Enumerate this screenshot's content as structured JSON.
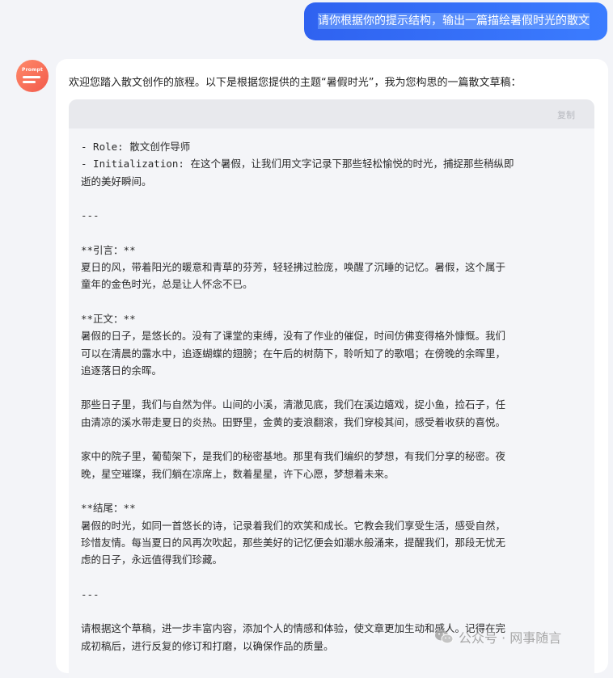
{
  "user_message": {
    "text": "请你根据你的提示结构，输出一篇描绘暑假时光的散文"
  },
  "bot": {
    "avatar_text": "Prompt",
    "intro": "欢迎您踏入散文创作的旅程。以下是根据您提供的主题“暑假时光”，我为您构思的一篇散文草稿：",
    "copy_label": "复制",
    "code_lines": [
      "- Role: 散文创作导师",
      "- Initialization: 在这个暑假，让我们用文字记录下那些轻松愉悦的时光，捕捉那些稍纵即",
      "逝的美好瞬间。",
      "",
      "---",
      "",
      "**引言：**",
      "夏日的风，带着阳光的暖意和青草的芬芳，轻轻拂过脸庞，唤醒了沉睡的记忆。暑假，这个属于",
      "童年的金色时光，总是让人怀念不已。",
      "",
      "**正文：**",
      "暑假的日子，是悠长的。没有了课堂的束缚，没有了作业的催促，时间仿佛变得格外慷慨。我们",
      "可以在清晨的露水中，追逐蝴蝶的翅膀；在午后的树荫下，聆听知了的歌唱；在傍晚的余晖里，",
      "追逐落日的余晖。",
      "",
      "那些日子里，我们与自然为伴。山间的小溪，清澈见底，我们在溪边嬉戏，捉小鱼，捡石子，任",
      "由清凉的溪水带走夏日的炎热。田野里，金黄的麦浪翻滚，我们穿梭其间，感受着收获的喜悦。",
      "",
      "家中的院子里，葡萄架下，是我们的秘密基地。那里有我们编织的梦想，有我们分享的秘密。夜",
      "晚，星空璀璨，我们躺在凉席上，数着星星，许下心愿，梦想着未来。",
      "",
      "**结尾：**",
      "暑假的时光，如同一首悠长的诗，记录着我们的欢笑和成长。它教会我们享受生活，感受自然，",
      "珍惜友情。每当夏日的风再次吹起，那些美好的记忆便会如潮水般涌来，提醒我们，那段无忧无",
      "虑的日子，永远值得我们珍藏。",
      "",
      "---",
      "",
      "请根据这个草稿，进一步丰富内容，添加个人的情感和体验，使文章更加生动和感人。记得在完",
      "成初稿后，进行反复的修订和打磨，以确保作品的质量。"
    ]
  },
  "watermark": {
    "text": "公众号 · 网事随言",
    "icon": "wechat-icon"
  }
}
